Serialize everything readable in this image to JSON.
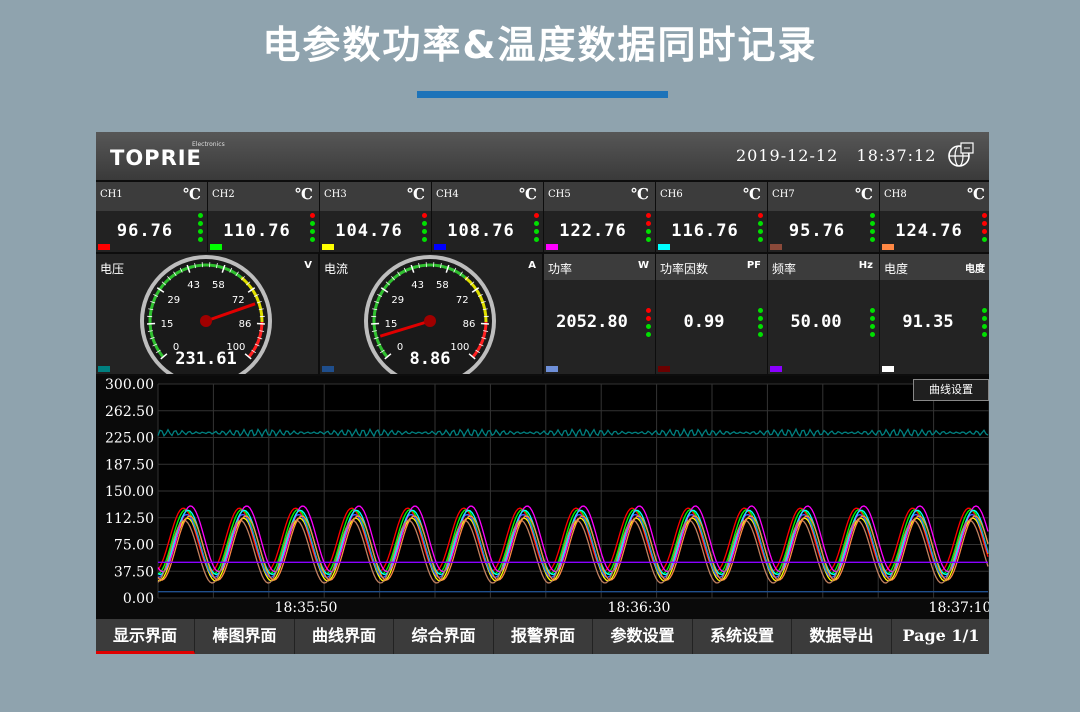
{
  "headline": "电参数功率&温度数据同时记录",
  "header": {
    "logo": "TOPRIE",
    "logo_sub": "Electronics",
    "date": "2019-12-12",
    "time": "18:37:12",
    "settings_icon": "globe-settings-icon"
  },
  "channels": [
    {
      "name": "CH1",
      "unit": "℃",
      "value": "96.76",
      "color": "#ff0000",
      "dots": [
        "#00e000",
        "#00e000",
        "#00e000",
        "#00e000"
      ]
    },
    {
      "name": "CH2",
      "unit": "℃",
      "value": "110.76",
      "color": "#00ff00",
      "dots": [
        "#ff0000",
        "#00e000",
        "#00e000",
        "#00e000"
      ]
    },
    {
      "name": "CH3",
      "unit": "℃",
      "value": "104.76",
      "color": "#ffff00",
      "dots": [
        "#ff0000",
        "#00e000",
        "#00e000",
        "#00e000"
      ]
    },
    {
      "name": "CH4",
      "unit": "℃",
      "value": "108.76",
      "color": "#0000ff",
      "dots": [
        "#ff0000",
        "#00e000",
        "#00e000",
        "#00e000"
      ]
    },
    {
      "name": "CH5",
      "unit": "℃",
      "value": "122.76",
      "color": "#ff00ff",
      "dots": [
        "#ff0000",
        "#ff0000",
        "#00e000",
        "#00e000"
      ]
    },
    {
      "name": "CH6",
      "unit": "℃",
      "value": "116.76",
      "color": "#00ffff",
      "dots": [
        "#ff0000",
        "#00e000",
        "#00e000",
        "#00e000"
      ]
    },
    {
      "name": "CH7",
      "unit": "℃",
      "value": "95.76",
      "color": "#8b4a3a",
      "dots": [
        "#00e000",
        "#00e000",
        "#00e000",
        "#00e000"
      ]
    },
    {
      "name": "CH8",
      "unit": "℃",
      "value": "124.76",
      "color": "#ff8844",
      "dots": [
        "#ff0000",
        "#ff0000",
        "#ff0000",
        "#00e000"
      ]
    }
  ],
  "gauges": [
    {
      "title": "电压",
      "unit": "V",
      "value": "231.61",
      "needle": 231.61,
      "max": 300,
      "ticks": [
        "0",
        "15",
        "29",
        "43",
        "58",
        "72",
        "86",
        "100"
      ],
      "color": "#008080"
    },
    {
      "title": "电流",
      "unit": "A",
      "value": "8.86",
      "needle": 8.86,
      "max": 100,
      "ticks": [
        "0",
        "15",
        "29",
        "43",
        "58",
        "72",
        "86",
        "100"
      ],
      "color": "#1f4e8c"
    }
  ],
  "meters": [
    {
      "title": "功率",
      "unit": "W",
      "value": "2052.80",
      "color": "#6e8fd8",
      "dots": [
        "#ff0000",
        "#ff0000",
        "#00e000",
        "#00e000"
      ]
    },
    {
      "title": "功率因数",
      "unit": "PF",
      "value": "0.99",
      "color": "#6a0000",
      "dots": [
        "#00e000",
        "#00e000",
        "#00e000",
        "#00e000"
      ]
    },
    {
      "title": "频率",
      "unit": "Hz",
      "value": "50.00",
      "color": "#8a00ff",
      "dots": [
        "#00e000",
        "#00e000",
        "#00e000",
        "#00e000"
      ]
    },
    {
      "title": "电度",
      "unit": "电度",
      "value": "91.35",
      "color": "#ffffff",
      "dots": [
        "#00e000",
        "#00e000",
        "#00e000",
        "#00e000"
      ]
    }
  ],
  "chart_button": "曲线设置",
  "chart_data": {
    "type": "line",
    "ylim": [
      0,
      300
    ],
    "yticks": [
      "300.00",
      "262.50",
      "225.00",
      "187.50",
      "150.00",
      "112.50",
      "75.00",
      "37.50",
      "0.00"
    ],
    "xticks": [
      "18:35:50",
      "18:36:30",
      "18:37:10"
    ],
    "series": [
      {
        "color": "#ff0000",
        "offset": 0,
        "amp": 44,
        "base": 82
      },
      {
        "color": "#00ff00",
        "offset": 6,
        "amp": 45,
        "base": 79
      },
      {
        "color": "#ffff00",
        "offset": 10,
        "amp": 44,
        "base": 68
      },
      {
        "color": "#4060ff",
        "offset": 8,
        "amp": 44,
        "base": 73
      },
      {
        "color": "#ff00ff",
        "offset": 18,
        "amp": 46,
        "base": 83
      },
      {
        "color": "#00ffff",
        "offset": 12,
        "amp": 45,
        "base": 78
      },
      {
        "color": "#c08060",
        "offset": 2,
        "amp": 44,
        "base": 65
      },
      {
        "color": "#ff8844",
        "offset": 16,
        "amp": 45,
        "base": 70
      },
      {
        "color": "#008080",
        "flat": true,
        "value": 231.61
      },
      {
        "color": "#8a00ff",
        "flat": true,
        "value": 50.0
      },
      {
        "color": "#1f4e8c",
        "flat": true,
        "value": 8.86
      }
    ]
  },
  "tabs": [
    "显示界面",
    "棒图界面",
    "曲线界面",
    "综合界面",
    "报警界面",
    "参数设置",
    "系统设置",
    "数据导出",
    "Page 1/1"
  ]
}
